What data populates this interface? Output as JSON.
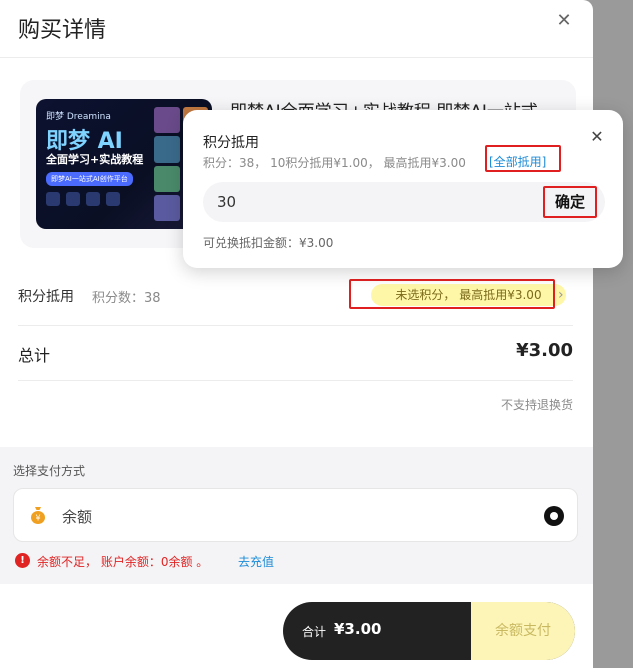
{
  "header": {
    "title": "购买详情"
  },
  "product": {
    "title": "即梦AI全面学习+实战教程 即梦AI一站式",
    "thumbnail": {
      "brand": "即梦 Dreamina",
      "headline": "即梦 AI",
      "subtitle": "全面学习+实战教程",
      "pill": "即梦AI一站式AI创作平台"
    }
  },
  "points_row": {
    "label": "积分抵用",
    "count_text": "积分数：38",
    "badge": "未选积分，  最高抵用¥3.00"
  },
  "total": {
    "label": "总计",
    "value": "¥3.00"
  },
  "no_refund": "不支持退换货",
  "payment": {
    "section_label": "选择支付方式",
    "method_name": "余额",
    "warning": "余额不足，  账户余额：0余额  。",
    "recharge_link": "去充值"
  },
  "footer": {
    "total_label": "合计",
    "total_value": "¥3.00",
    "pay_button": "余额支付"
  },
  "popover": {
    "title": "积分抵用",
    "info": "积分：38，  10积分抵用¥1.00，  最高抵用¥3.00",
    "use_all": "[全部抵用]",
    "input_value": "30",
    "confirm": "确定",
    "exchange": "可兑换抵扣金额：¥3.00"
  },
  "colors": {
    "accent_red": "#e02020",
    "link_blue": "#1c8bd6",
    "badge_yellow": "#fff7a8",
    "pay_button_bg": "#fdf5b8"
  }
}
